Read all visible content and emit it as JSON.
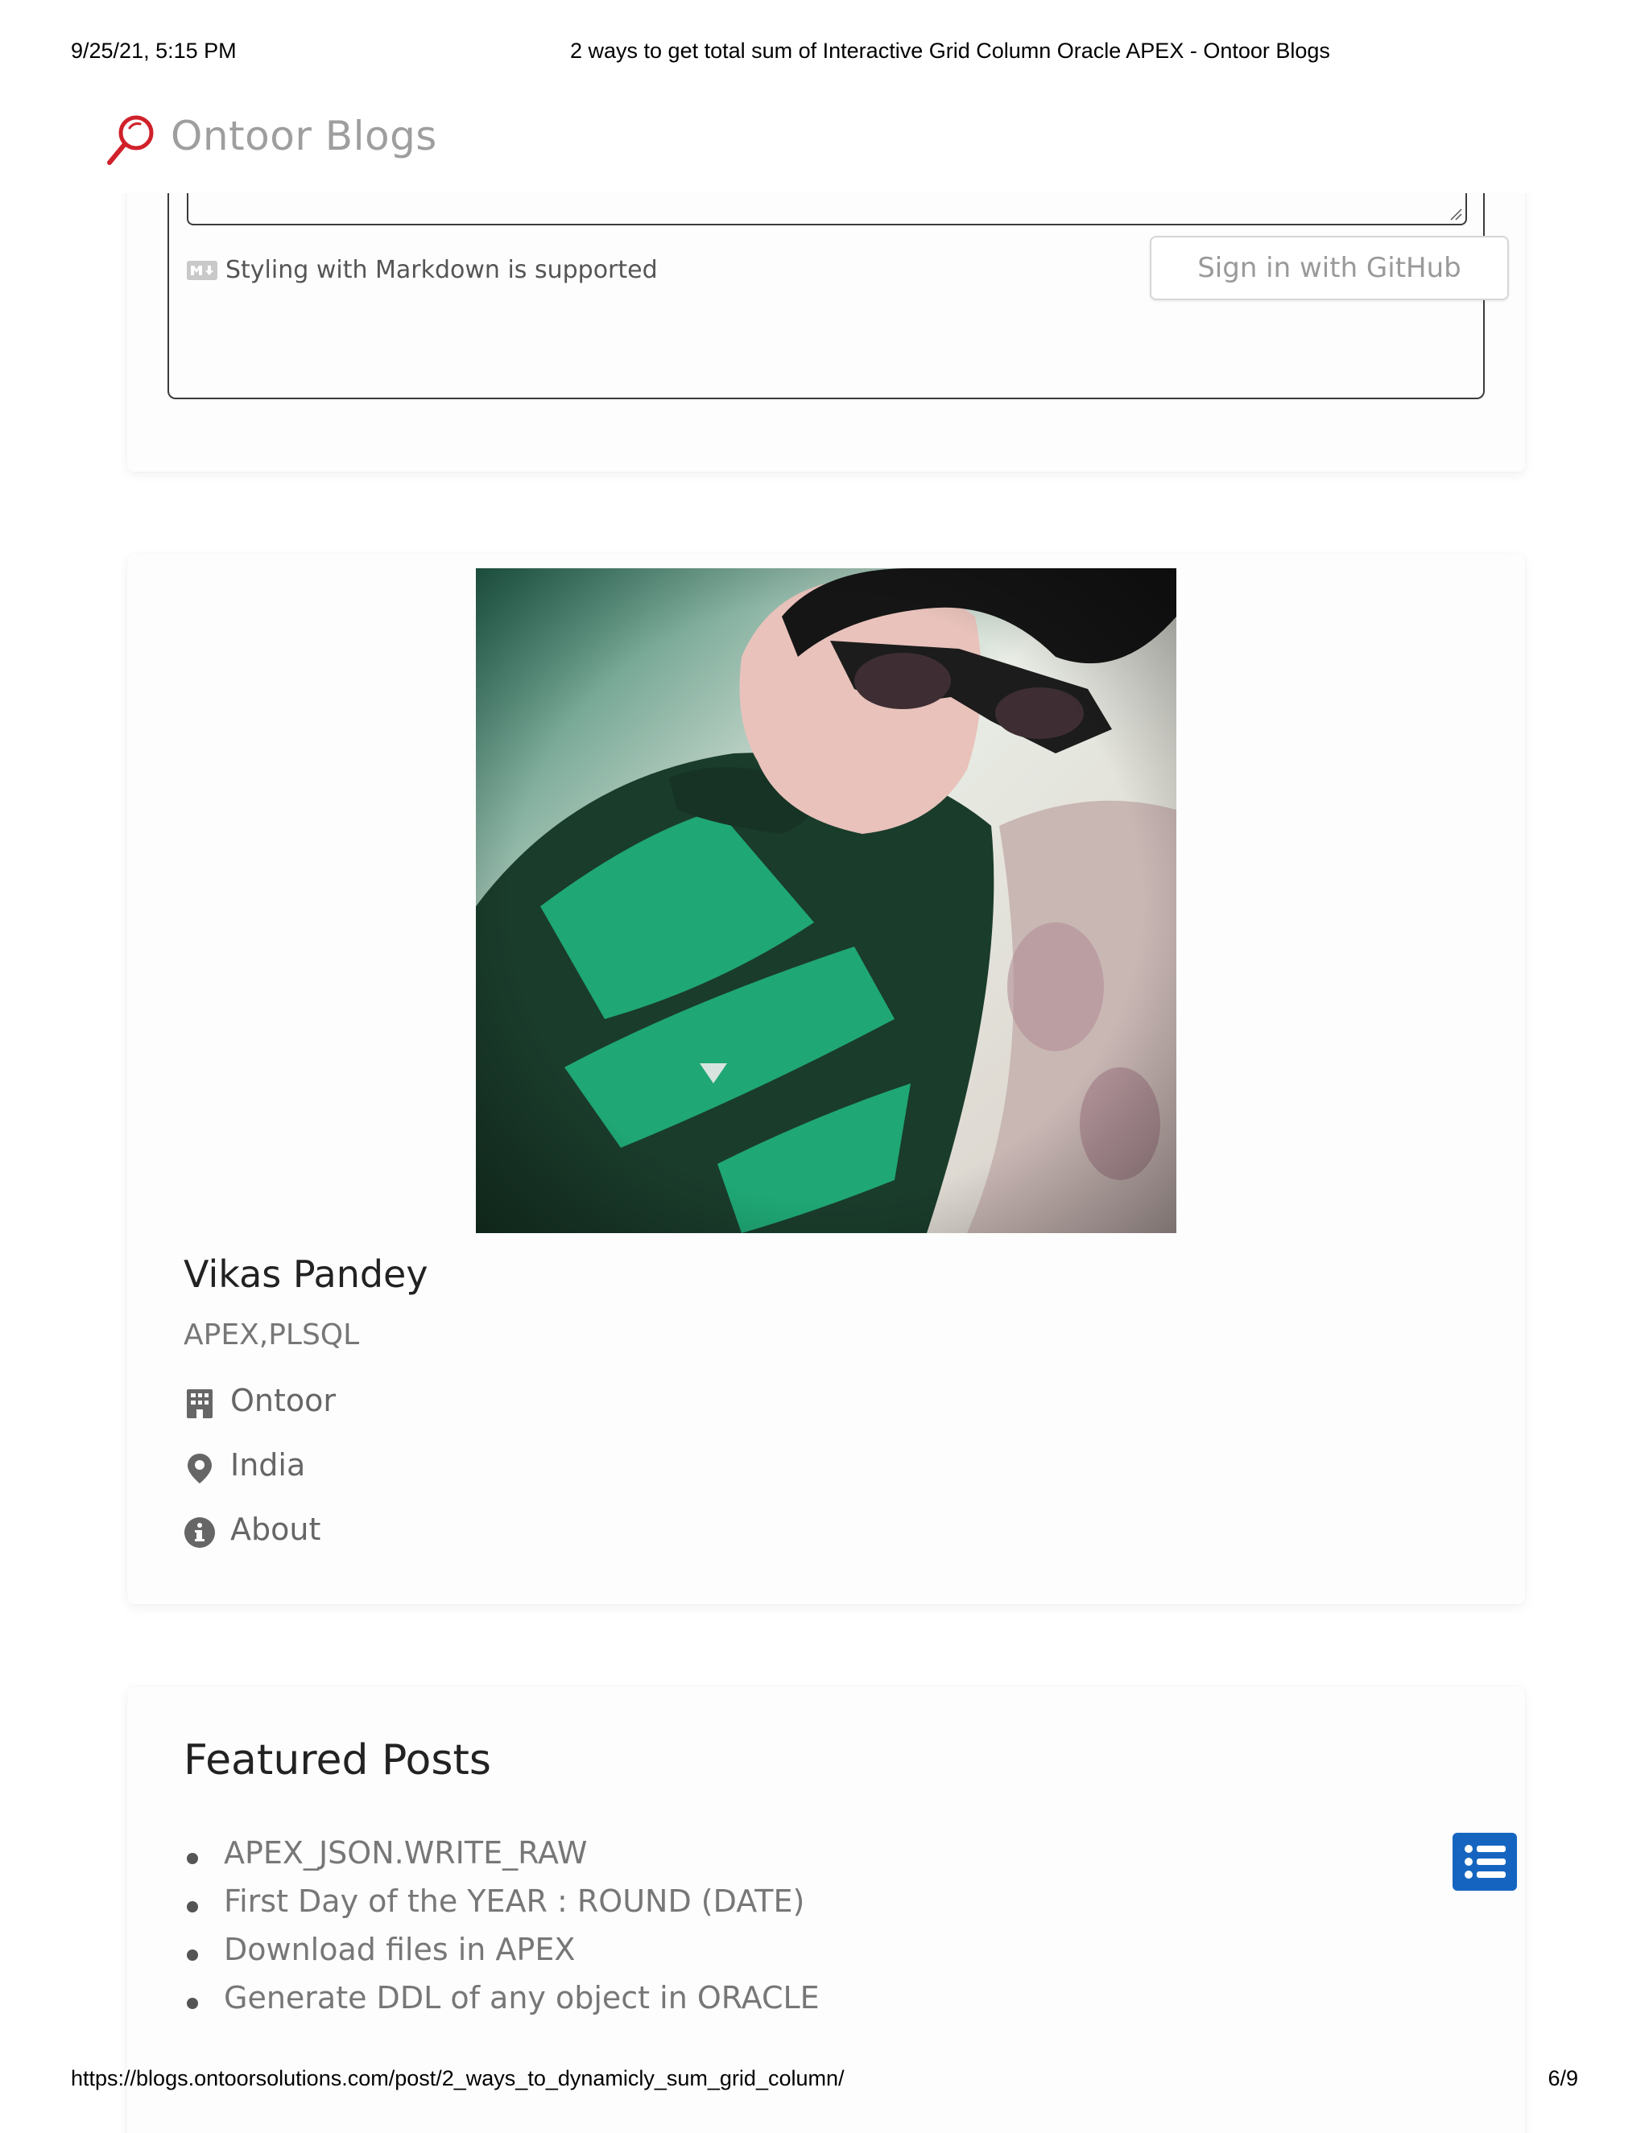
{
  "print_header": {
    "datetime": "9/25/21, 5:15 PM",
    "page_title": "2 ways to get total sum of Interactive Grid Column Oracle APEX - Ontoor Blogs"
  },
  "site": {
    "title": "Ontoor Blogs",
    "logo_icon": "magnifier-logo-icon",
    "accent_color": "#d0202a"
  },
  "comments": {
    "markdown_note": "Styling with Markdown is supported",
    "markdown_icon": "markdown-icon",
    "signin_label": "Sign in with GitHub",
    "textarea_value": ""
  },
  "author": {
    "photo": "author-photo",
    "name": "Vikas Pandey",
    "tags": "APEX,PLSQL",
    "company": "Ontoor",
    "company_icon": "building-icon",
    "location": "India",
    "location_icon": "map-pin-icon",
    "about": "About",
    "about_icon": "info-icon"
  },
  "featured": {
    "title": "Featured Posts",
    "posts": [
      "APEX_JSON.WRITE_RAW",
      "First Day of the YEAR : ROUND (DATE)",
      "Download files in APEX",
      "Generate DDL of any object in ORACLE"
    ],
    "toc_icon": "list-icon",
    "toc_color": "#1565c0"
  },
  "print_footer": {
    "url": "https://blogs.ontoorsolutions.com/post/2_ways_to_dynamicly_sum_grid_column/",
    "page": "6/9"
  }
}
